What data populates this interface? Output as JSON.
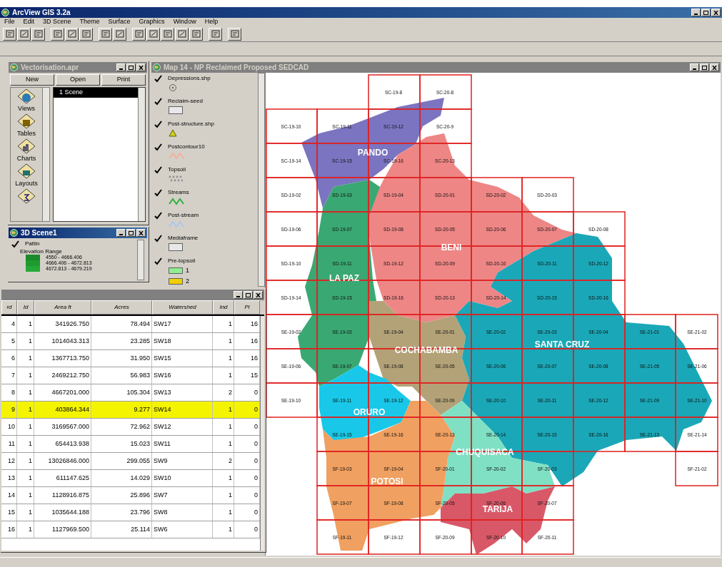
{
  "app": {
    "title": "ArcView GIS 3.2a",
    "menu": [
      "File",
      "Edit",
      "3D Scene",
      "Theme",
      "Surface",
      "Graphics",
      "Window",
      "Help"
    ]
  },
  "project_window": {
    "title": "Vectorisation.apr",
    "active": false,
    "buttons": [
      "New",
      "Open",
      "Print"
    ],
    "doc_types": [
      {
        "kind": "views",
        "label": "Views"
      },
      {
        "kind": "tables",
        "label": "Tables"
      },
      {
        "kind": "charts",
        "label": "Charts"
      },
      {
        "kind": "layouts",
        "label": "Layouts"
      },
      {
        "kind": "scripts"
      }
    ],
    "documents": [
      {
        "label": "1 Scene",
        "selected": true
      }
    ]
  },
  "scene_window": {
    "title": "3D Scene1",
    "active": true,
    "theme": {
      "name": "Pattin",
      "checked": true,
      "subtitle": "Elevation Range",
      "classes": [
        {
          "label": "4550 - 4666.406",
          "color": "#1a8a2a"
        },
        {
          "label": "4666.406 - 4672.813",
          "color": "#1f9a30"
        },
        {
          "label": "4672.813 - 4679.219",
          "color": "#25a838"
        }
      ]
    }
  },
  "map_window": {
    "title": "Map 14 - NP Reclaimed Proposed SEDCAD",
    "active": false,
    "themes": [
      {
        "name": "Depressions.shp",
        "checked": true,
        "kind": "point",
        "color": "#606060"
      },
      {
        "name": "Reclaim-seed",
        "checked": true,
        "kind": "polygon",
        "color": "#e8e8e8"
      },
      {
        "name": "Post-structure.shp",
        "checked": true,
        "kind": "triangle",
        "color": "#d0d020"
      },
      {
        "name": "Postcontour10",
        "checked": true,
        "kind": "line",
        "color": "#f0b0a0"
      },
      {
        "name": "Topsoil",
        "checked": true,
        "kind": "dots",
        "color": "#909090"
      },
      {
        "name": "Streams",
        "checked": true,
        "kind": "line",
        "color": "#30b040"
      },
      {
        "name": "Post-stream",
        "checked": true,
        "kind": "line",
        "color": "#a8c8e8"
      },
      {
        "name": "Mediaframe",
        "checked": true,
        "kind": "polygon",
        "color": "#e8e8e8"
      },
      {
        "name": "Pre-topsoil",
        "checked": true,
        "kind": "classes",
        "classes": [
          {
            "label": "1",
            "color": "#90ee90"
          },
          {
            "label": "2",
            "color": "#f0d000"
          }
        ]
      }
    ],
    "map": {
      "regions": [
        {
          "name": "PANDO",
          "color": "#7b74c0"
        },
        {
          "name": "BENI",
          "color": "#ee8686"
        },
        {
          "name": "LA PAZ",
          "color": "#3aa872"
        },
        {
          "name": "COCHABAMBA",
          "color": "#b3a278"
        },
        {
          "name": "SANTA CRUZ",
          "color": "#1aa8b8"
        },
        {
          "name": "ORURO",
          "color": "#19c8e8"
        },
        {
          "name": "CHUQUISACA",
          "color": "#80e0c4"
        },
        {
          "name": "POTOSI",
          "color": "#f0a060"
        },
        {
          "name": "TARIJA",
          "color": "#d85868"
        }
      ],
      "tile_rows": [
        [
          null,
          null,
          "SC-19-8",
          "SC-20-8"
        ],
        [
          "SC-19-10",
          "SC-19-11",
          "SC-19-12",
          "SC-20-9"
        ],
        [
          "SC-19-14",
          "SC-19-15",
          "SC-19-16",
          "SC-20-13"
        ],
        [
          "SD-19-02",
          "SD-19-03",
          "SD-19-04",
          "SD-20-01",
          "SD-20-02",
          "SD-20-03"
        ],
        [
          "SD-19-06",
          "SD-19-07",
          "SD-19-08",
          "SD-20-05",
          "SD-20-06",
          "SD-20-07",
          "SD-20-08"
        ],
        [
          "SD-19-10",
          "SD-19-11",
          "SD-19-12",
          "SD-20-09",
          "SD-20-10",
          "SD-20-11",
          "SD-20-12"
        ],
        [
          "SD-19-14",
          "SD-19-15",
          "SD-19-16",
          "SD-20-13",
          "SD-20-14",
          "SD-20-15",
          "SD-20-16"
        ],
        [
          "SE-19-02",
          "SE-19-03",
          "SE-19-04",
          "SE-20-01",
          "SE-20-02",
          "SE-20-03",
          "SE-20-04",
          "SE-21-01",
          "SE-21-02"
        ],
        [
          "SE-19-06",
          "SE-19-07",
          "SE-19-08",
          "SE-20-05",
          "SE-20-06",
          "SE-20-07",
          "SE-20-08",
          "SE-21-05",
          "SE-21-06"
        ],
        [
          "SE-19-10",
          "SE-19-11",
          "SE-19-12",
          "SE-20-09",
          "SE-20-10",
          "SE-20-11",
          "SE-20-12",
          "SE-21-09",
          "SE-21-10"
        ],
        [
          null,
          "SE-19-15",
          "SE-19-16",
          "SE-20-13",
          "SE-20-14",
          "SE-20-15",
          "SE-20-16",
          "SE-21-13",
          "SE-21-14"
        ],
        [
          null,
          "SF-19-03",
          "SF-19-04",
          "SF-20-01",
          "SF-20-02",
          "SF-20-03",
          null,
          null,
          "SF-21-02"
        ],
        [
          null,
          "SF-19-07",
          "SF-19-08",
          "SF-20-05",
          "SF-20-06",
          "SF-20-07"
        ],
        [
          null,
          "SF-19-11",
          "SF-19-12",
          "SF-20-09",
          "SF-20-10",
          "SF-20-11"
        ]
      ]
    }
  },
  "table_window": {
    "active": false,
    "columns": [
      "rd",
      "Id",
      "Area ft",
      "Acres",
      "Watershed",
      "Ind",
      "Pi"
    ],
    "rows": [
      {
        "cells": [
          "4",
          "1",
          "341926.750",
          "78.494",
          "SW17",
          "1",
          "16"
        ],
        "selected": false
      },
      {
        "cells": [
          "5",
          "1",
          "1014043.313",
          "23.285",
          "SW18",
          "1",
          "16"
        ],
        "selected": false
      },
      {
        "cells": [
          "6",
          "1",
          "1367713.750",
          "31.950",
          "SW15",
          "1",
          "16"
        ],
        "selected": false
      },
      {
        "cells": [
          "7",
          "1",
          "2469212.750",
          "56.983",
          "SW16",
          "1",
          "15"
        ],
        "selected": false
      },
      {
        "cells": [
          "8",
          "1",
          "4667201.000",
          "105.304",
          "SW13",
          "2",
          "0"
        ],
        "selected": false
      },
      {
        "cells": [
          "9",
          "1",
          "403864.344",
          "9.277",
          "SW14",
          "1",
          "0"
        ],
        "selected": true
      },
      {
        "cells": [
          "10",
          "1",
          "3169567.000",
          "72.962",
          "SW12",
          "1",
          "0"
        ],
        "selected": false
      },
      {
        "cells": [
          "11",
          "1",
          "654413.938",
          "15.023",
          "SW11",
          "1",
          "0"
        ],
        "selected": false
      },
      {
        "cells": [
          "12",
          "1",
          "13026846.000",
          "299.055",
          "SW9",
          "2",
          "0"
        ],
        "selected": false
      },
      {
        "cells": [
          "13",
          "1",
          "611147.625",
          "14.029",
          "SW10",
          "1",
          "0"
        ],
        "selected": false
      },
      {
        "cells": [
          "14",
          "1",
          "1128916.875",
          "25.896",
          "SW7",
          "1",
          "0"
        ],
        "selected": false
      },
      {
        "cells": [
          "15",
          "1",
          "1035644.188",
          "23.796",
          "SW8",
          "1",
          "0"
        ],
        "selected": false
      },
      {
        "cells": [
          "16",
          "1",
          "1127969.500",
          "25.114",
          "SW6",
          "1",
          "0"
        ],
        "selected": false
      }
    ]
  }
}
